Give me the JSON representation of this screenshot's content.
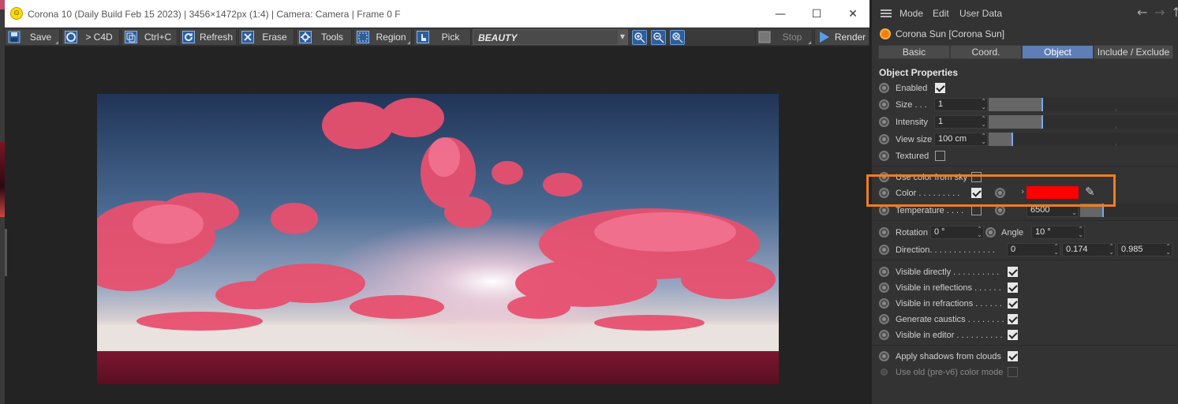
{
  "vfb": {
    "title": "Corona 10 (Daily Build Feb 15 2023) | 3456×1472px (1:4) | Camera: Camera | Frame 0 F",
    "window_controls": [
      "—",
      "☐",
      "✕"
    ],
    "toolbar": {
      "save": "Save",
      "to_c4d": "> C4D",
      "copy": "Ctrl+C",
      "refresh": "Refresh",
      "erase": "Erase",
      "tools": "Tools",
      "region": "Region",
      "pick": "Pick",
      "channel": "BEAUTY",
      "stop": "Stop",
      "render": "Render"
    },
    "icons": [
      "save-icon",
      "c4d-icon",
      "copy-icon",
      "refresh-icon",
      "erase-icon",
      "tools-icon",
      "region-icon",
      "pick-icon",
      "zoom-in-icon",
      "zoom-out-icon",
      "zoom-fit-icon",
      "stop-icon",
      "render-icon"
    ]
  },
  "attribute_manager": {
    "menu": [
      "Mode",
      "Edit",
      "User Data"
    ],
    "object_title": "Corona Sun [Corona Sun]",
    "tabs": [
      "Basic",
      "Coord.",
      "Object",
      "Include / Exclude"
    ],
    "active_tab": "Object",
    "section_title": "Object Properties",
    "enabled": {
      "label": "Enabled",
      "checked": true
    },
    "size": {
      "label": "Size . . .",
      "value": "1",
      "level": 0.28
    },
    "intensity": {
      "label": "Intensity",
      "value": "1",
      "level": 0.28
    },
    "view_size": {
      "label": "View size",
      "value": "100 cm",
      "level": 0.12
    },
    "textured": {
      "label": "Textured",
      "checked": false
    },
    "use_color_from_sky": {
      "label": "Use color from sky",
      "checked": false
    },
    "color": {
      "label": "Color . . . . . . . . .",
      "checked": true,
      "swatch": "#ff0000"
    },
    "temperature": {
      "label": "Temperature . . . .",
      "checked": false,
      "value": "6500"
    },
    "rotation": {
      "label": "Rotation",
      "value": "0 °"
    },
    "angle": {
      "label": "Angle",
      "value": "10 °"
    },
    "direction": {
      "label": "Direction. . . . . . . . . . . . . .",
      "x": "0",
      "y": "0.174",
      "z": "0.985"
    },
    "visibility": [
      {
        "label": "Visible directly . . . . . . . . . .",
        "checked": true
      },
      {
        "label": "Visible in reflections . . . . . .",
        "checked": true
      },
      {
        "label": "Visible in refractions . . . . . .",
        "checked": true
      },
      {
        "label": "Generate caustics . . . . . . . .",
        "checked": true
      },
      {
        "label": "Visible in editor . . . . . . . . . .",
        "checked": true
      }
    ],
    "apply_shadows": {
      "label": "Apply shadows from clouds",
      "checked": true
    },
    "use_old_color": {
      "label": "Use old (pre-v6) color mode",
      "checked": false
    },
    "highlight_color": "#ef7d22"
  }
}
